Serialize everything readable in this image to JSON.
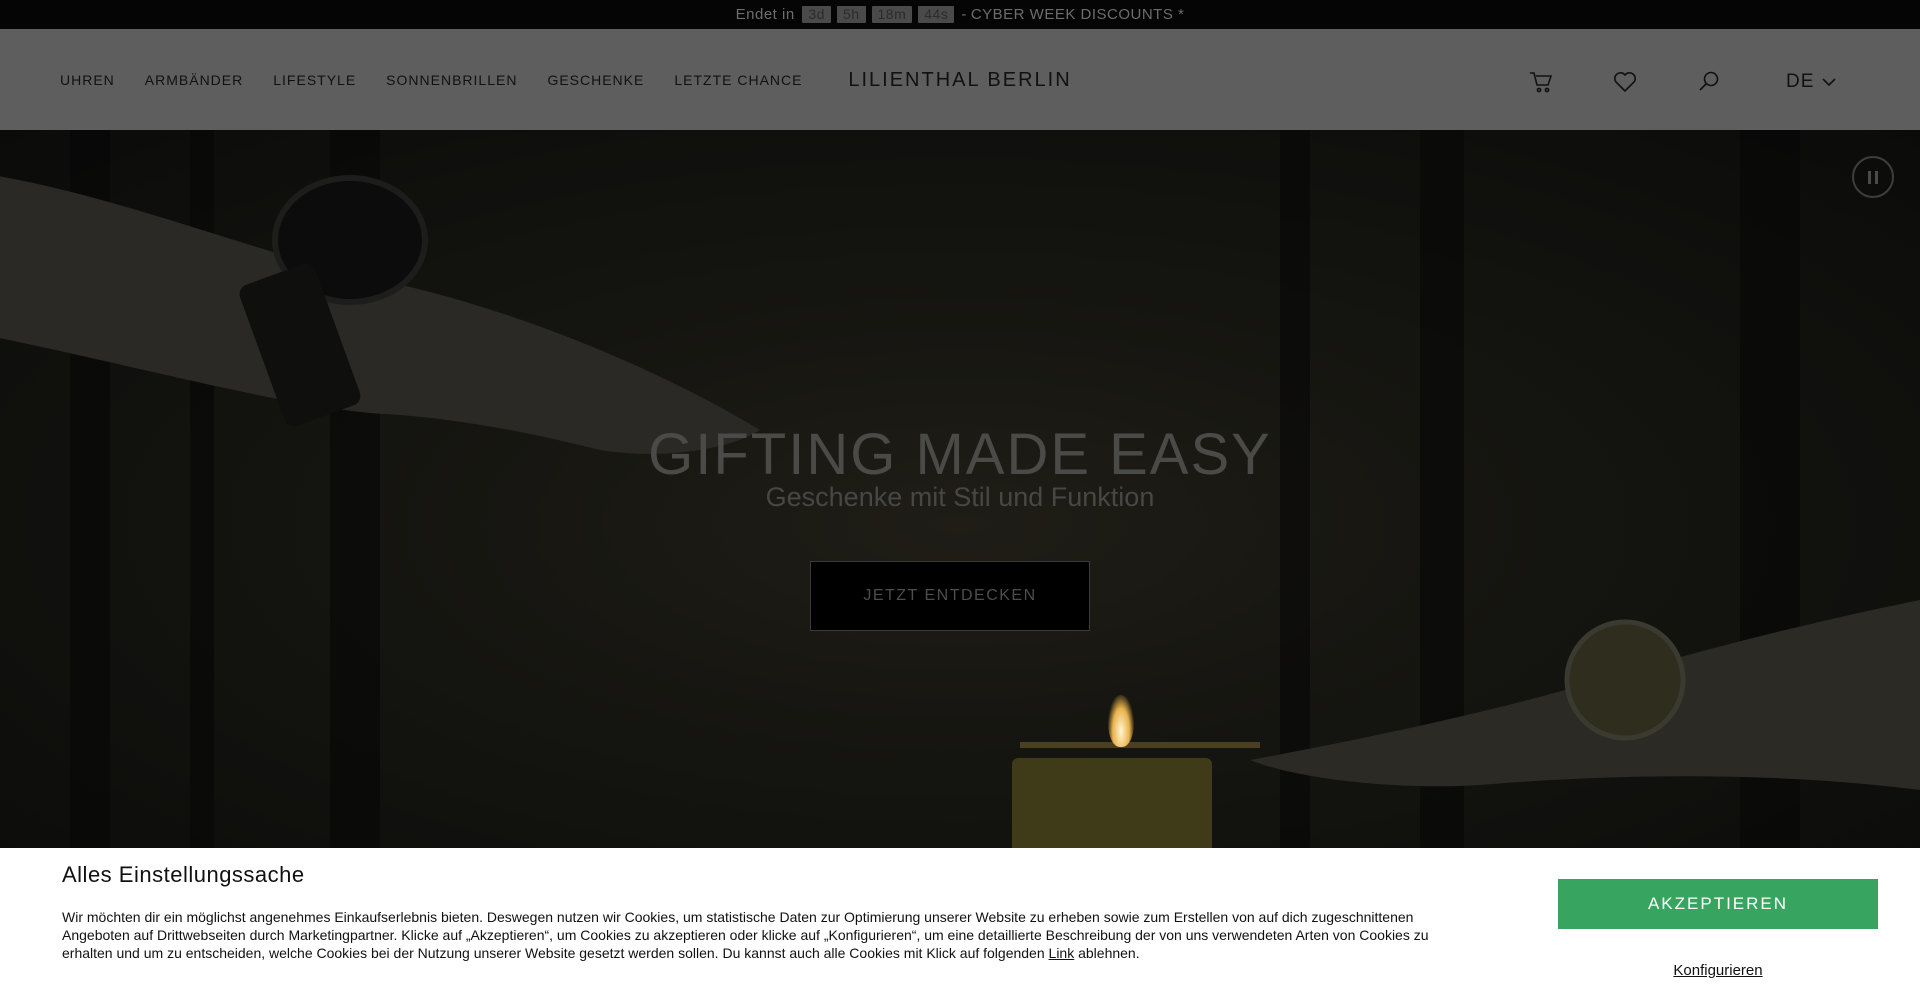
{
  "topbar": {
    "prefix": "Endet in",
    "countdown": [
      "3d",
      "5h",
      "18m",
      "44s"
    ],
    "separator": "-",
    "promo": "CYBER WEEK DISCOUNTS *"
  },
  "header": {
    "nav": [
      "UHREN",
      "ARMBÄNDER",
      "LIFESTYLE",
      "SONNENBRILLEN",
      "GESCHENKE",
      "LETZTE CHANCE"
    ],
    "logo": "LILIENTHAL BERLIN",
    "language": "DE"
  },
  "hero": {
    "title": "GIFTING MADE EASY",
    "subtitle": "Geschenke mit Stil und Funktion",
    "cta": "JETZT ENTDECKEN"
  },
  "cookie": {
    "title": "Alles Einstellungssache",
    "text_before_link": "Wir möchten dir ein möglichst angenehmes Einkaufserlebnis bieten. Deswegen nutzen wir Cookies, um statistische Daten zur Optimierung unserer Website zu erheben sowie zum Erstellen von auf dich zugeschnittenen Angeboten auf Drittwebseiten durch Marketingpartner. Klicke auf „Akzeptieren“, um Cookies zu akzeptieren oder klicke auf „Konfigurieren“, um eine detaillierte Beschreibung der von uns verwendeten Arten von Cookies zu erhalten und um zu entscheiden, welche Cookies bei der Nutzung unserer Website gesetzt werden sollen. Du kannst auch alle Cookies mit Klick auf folgenden",
    "link_text": "Link",
    "text_after_link": "ablehnen.",
    "accept": "AKZEPTIEREN",
    "configure": "Konfigurieren"
  },
  "colors": {
    "accept_button": "#37a55f",
    "overlay_header": "#5e5e5e"
  },
  "icons": [
    "cart-icon",
    "heart-icon",
    "search-icon",
    "chevron-down-icon",
    "pause-icon"
  ]
}
